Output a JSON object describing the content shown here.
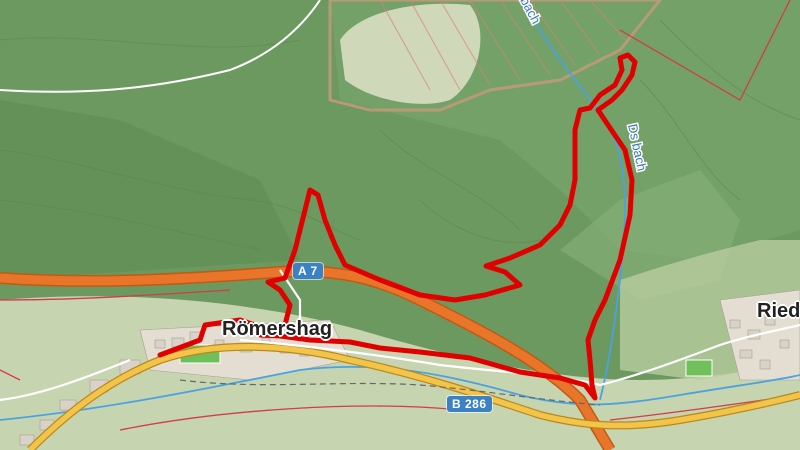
{
  "map": {
    "roads": [
      {
        "ref": "A 7",
        "kind": "motorway"
      },
      {
        "ref": "B 286",
        "kind": "federal-road"
      }
    ],
    "places": [
      {
        "name": "Römershag",
        "kind": "village"
      },
      {
        "name": "Ried",
        "kind": "village"
      }
    ],
    "waterways": [
      {
        "name": "bach",
        "kind": "stream"
      },
      {
        "name": "Ds bach",
        "kind": "stream"
      }
    ],
    "route": {
      "color": "#e00000"
    },
    "colors": {
      "forest": "#6f9a63",
      "meadow": "#c9d6b3",
      "motorway": "#e8752a",
      "federal_road": "#f3c44a",
      "water": "#4aa3e0",
      "boundary": "#d43a4a"
    }
  }
}
